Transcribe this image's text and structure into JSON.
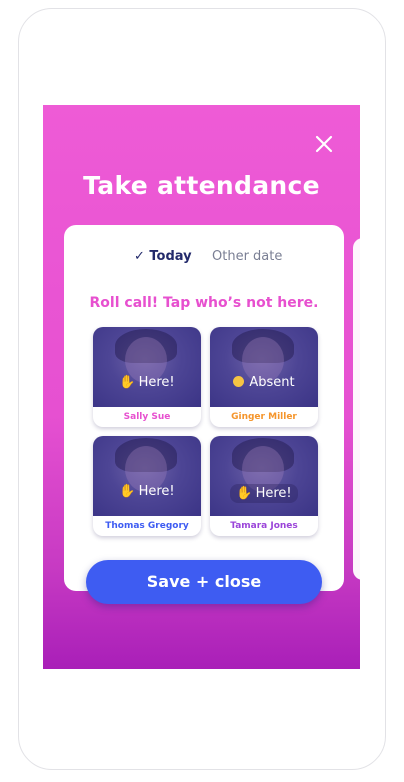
{
  "title": "Take attendance",
  "tabs": {
    "today": "✓ Today",
    "other": "Other date"
  },
  "prompt": "Roll call! Tap who’s not here.",
  "students": [
    {
      "name": "Sally Sue",
      "status": "Here!",
      "emoji": "✋",
      "name_color": "#e750cf"
    },
    {
      "name": "Ginger Miller",
      "status": "Absent",
      "emoji": "",
      "name_color": "#f5952b"
    },
    {
      "name": "Thomas Gregory",
      "status": "Here!",
      "emoji": "✋",
      "name_color": "#3e5cf2"
    },
    {
      "name": "Tamara Jones",
      "status": "Here!",
      "emoji": "✋",
      "name_color": "#9b45d9"
    }
  ],
  "save_button": "Save + close",
  "colors": {
    "accent_pink": "#e750cf",
    "primary_blue": "#3e5cf2",
    "header_gradient_top": "#ee5bd6",
    "header_gradient_bottom": "#a91fb8"
  }
}
